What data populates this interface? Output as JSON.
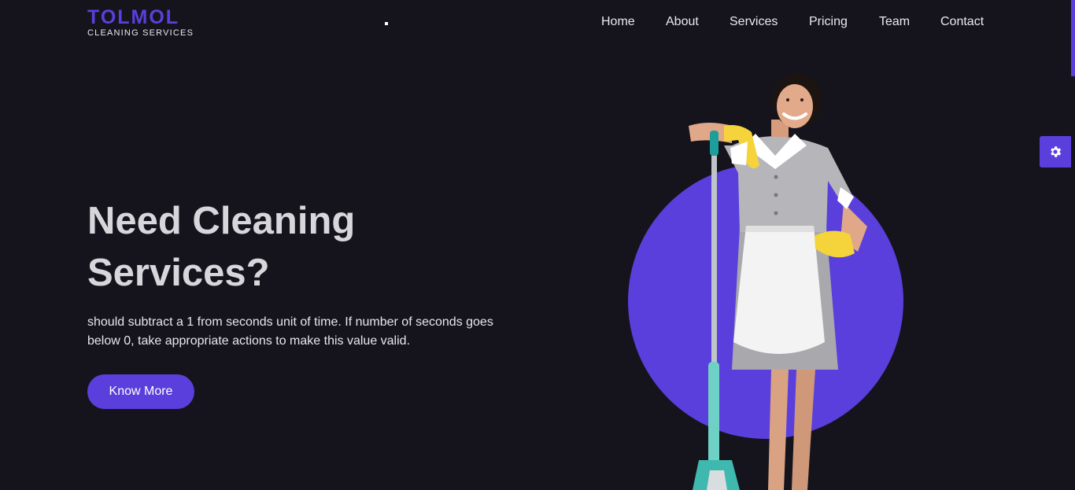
{
  "brand": {
    "title": "TOLMOL",
    "subtitle": "CLEANING SERVICES",
    "accent_color": "#5a3fdc"
  },
  "nav": {
    "items": [
      {
        "label": "Home"
      },
      {
        "label": "About"
      },
      {
        "label": "Services"
      },
      {
        "label": "Pricing"
      },
      {
        "label": "Team"
      },
      {
        "label": "Contact"
      }
    ]
  },
  "hero": {
    "title_line1": "Need Cleaning",
    "title_line2": "Services?",
    "description": "should subtract a 1 from seconds unit of time. If number of seconds goes below 0, take appropriate actions to make this value valid.",
    "cta_label": "Know More",
    "image": "cleaning-woman-with-mop"
  },
  "widgets": {
    "settings_icon": "gear-icon"
  },
  "colors": {
    "background": "#15141d",
    "accent": "#5a3fdc"
  }
}
